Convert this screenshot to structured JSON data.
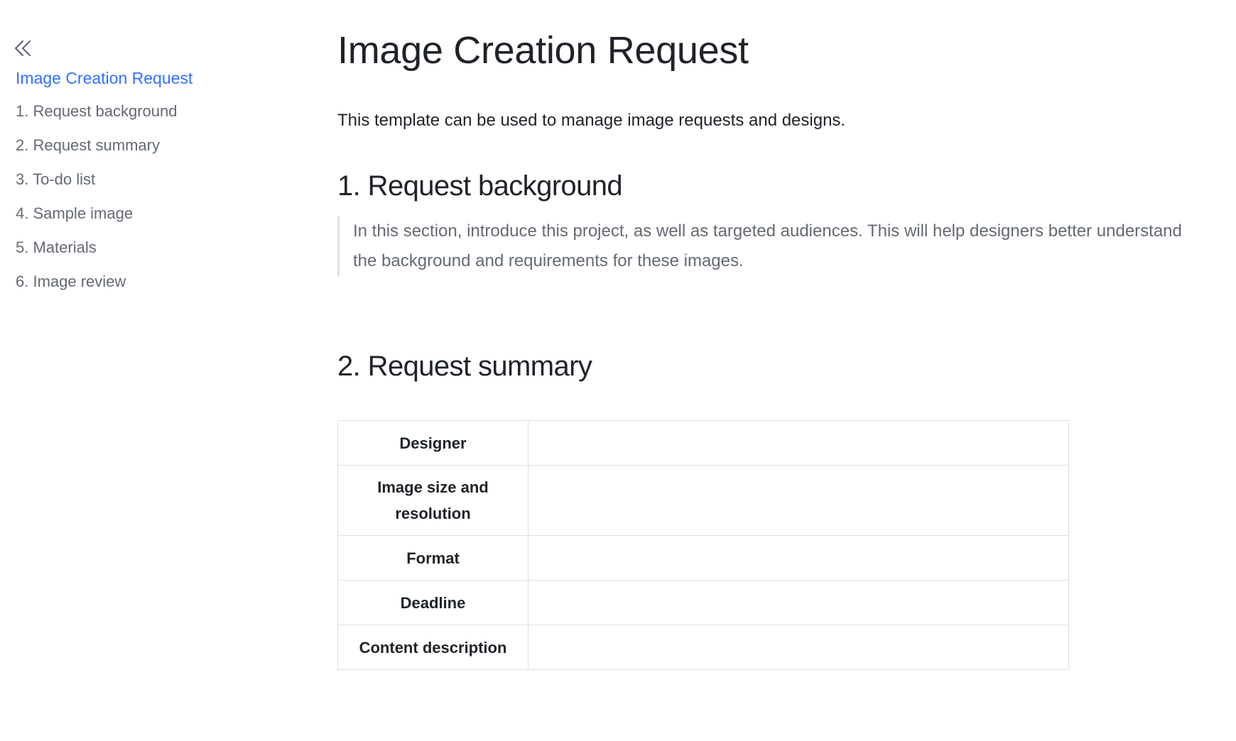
{
  "sidebar": {
    "collapse_icon": "double-chevron-left-icon",
    "toc": [
      {
        "label": "Image Creation Request",
        "active": true
      },
      {
        "label": "1. Request background",
        "active": false
      },
      {
        "label": "2. Request summary",
        "active": false
      },
      {
        "label": "3. To-do list",
        "active": false
      },
      {
        "label": "4. Sample image",
        "active": false
      },
      {
        "label": "5. Materials",
        "active": false
      },
      {
        "label": "6. Image review",
        "active": false
      }
    ]
  },
  "document": {
    "title": "Image Creation Request",
    "intro": "This template can be used to manage image requests and designs.",
    "section1": {
      "heading": "1. Request background",
      "quote": "In this section, introduce this project, as well as targeted audiences. This will help designers better understand the background and requirements for these images."
    },
    "section2": {
      "heading": "2. Request summary",
      "table": [
        {
          "label": "Designer",
          "value": ""
        },
        {
          "label": "Image size and resolution",
          "value": ""
        },
        {
          "label": "Format",
          "value": ""
        },
        {
          "label": "Deadline",
          "value": ""
        },
        {
          "label": "Content description",
          "value": ""
        }
      ]
    }
  },
  "colors": {
    "accent": "#3370ff",
    "text_primary": "#1f2329",
    "text_secondary": "#646a73",
    "border": "#dee0e3"
  }
}
